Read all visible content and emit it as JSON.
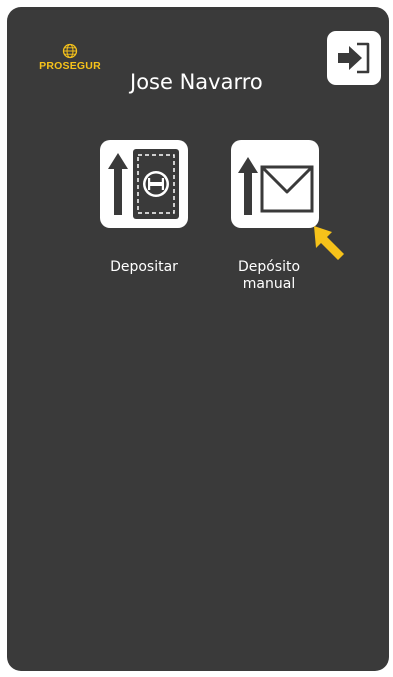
{
  "header": {
    "logo_text": "PROSEGUR",
    "user_name": "Jose Navarro",
    "logout_icon": "logout-arrow-icon"
  },
  "actions": [
    {
      "label": "Depositar",
      "icon": "deposit-cash-icon"
    },
    {
      "label": "Depósito manual",
      "icon": "deposit-envelope-icon"
    }
  ],
  "colors": {
    "panel": "#3a3a3a",
    "accent": "#f6c21a",
    "tile": "#ffffff"
  }
}
